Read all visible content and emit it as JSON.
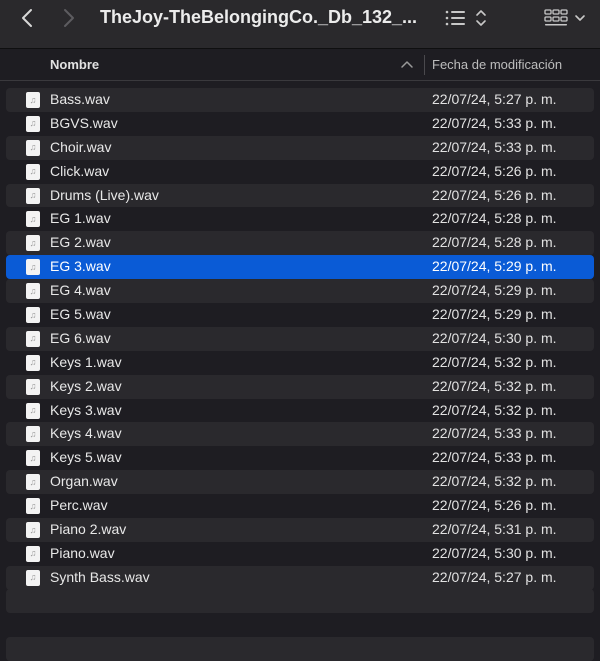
{
  "toolbar": {
    "title": "TheJoy-TheBelongingCo._Db_132_...",
    "back_icon": "chevron-left-icon",
    "forward_icon": "chevron-right-icon",
    "list_view_icon": "list-view-icon",
    "grid_view_icon": "grid-view-icon"
  },
  "columns": {
    "name": "Nombre",
    "date": "Fecha de modificación"
  },
  "files": [
    {
      "name": "Bass.wav",
      "date": "22/07/24, 5:27 p. m."
    },
    {
      "name": "BGVS.wav",
      "date": "22/07/24, 5:33 p. m."
    },
    {
      "name": "Choir.wav",
      "date": "22/07/24, 5:33 p. m."
    },
    {
      "name": "Click.wav",
      "date": "22/07/24, 5:26 p. m."
    },
    {
      "name": "Drums (Live).wav",
      "date": "22/07/24, 5:26 p. m."
    },
    {
      "name": "EG 1.wav",
      "date": "22/07/24, 5:28 p. m."
    },
    {
      "name": "EG 2.wav",
      "date": "22/07/24, 5:28 p. m."
    },
    {
      "name": "EG 3.wav",
      "date": "22/07/24, 5:29 p. m."
    },
    {
      "name": "EG 4.wav",
      "date": "22/07/24, 5:29 p. m."
    },
    {
      "name": "EG 5.wav",
      "date": "22/07/24, 5:29 p. m."
    },
    {
      "name": "EG 6.wav",
      "date": "22/07/24, 5:30 p. m."
    },
    {
      "name": "Keys 1.wav",
      "date": "22/07/24, 5:32 p. m."
    },
    {
      "name": "Keys 2.wav",
      "date": "22/07/24, 5:32 p. m."
    },
    {
      "name": "Keys 3.wav",
      "date": "22/07/24, 5:32 p. m."
    },
    {
      "name": "Keys 4.wav",
      "date": "22/07/24, 5:33 p. m."
    },
    {
      "name": "Keys 5.wav",
      "date": "22/07/24, 5:33 p. m."
    },
    {
      "name": "Organ.wav",
      "date": "22/07/24, 5:32 p. m."
    },
    {
      "name": "Perc.wav",
      "date": "22/07/24, 5:26 p. m."
    },
    {
      "name": "Piano 2.wav",
      "date": "22/07/24, 5:31 p. m."
    },
    {
      "name": "Piano.wav",
      "date": "22/07/24, 5:30 p. m."
    },
    {
      "name": "Synth Bass.wav",
      "date": "22/07/24, 5:27 p. m."
    }
  ],
  "selected_file": "EG 3.wav",
  "colors": {
    "background": "#1e1d22",
    "alt_row": "#2a292d",
    "selection": "#0a5bd6"
  }
}
